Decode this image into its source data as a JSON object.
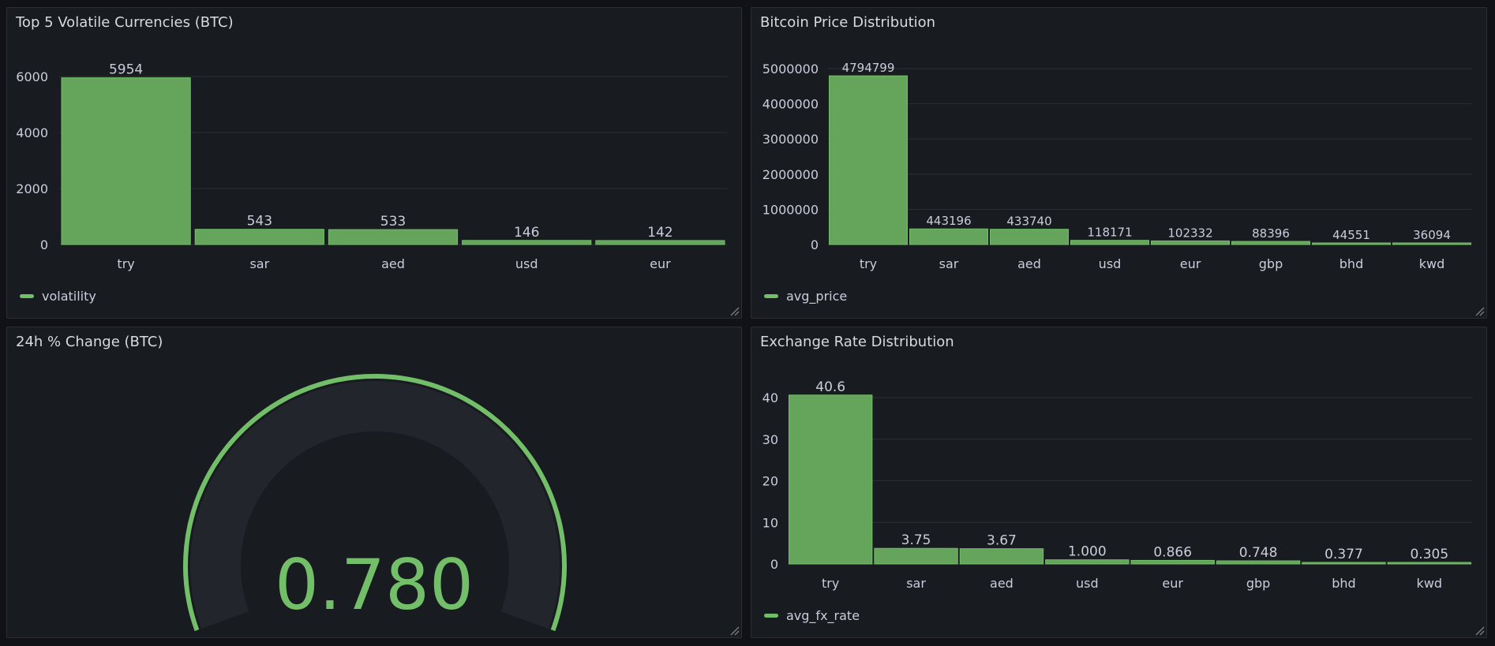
{
  "colors": {
    "bar_fill": "#64a55b",
    "bar_stroke": "#73bf69",
    "accent": "#73bf69",
    "grid": "#2c2f35",
    "axis_text": "#ccccdc",
    "gauge_track": "#22252b"
  },
  "icons": {
    "resize": "resize-handle-icon"
  },
  "panels": {
    "volatility": {
      "title": "Top 5 Volatile Currencies (BTC)",
      "legend": "volatility"
    },
    "price": {
      "title": "Bitcoin Price Distribution",
      "legend": "avg_price"
    },
    "change": {
      "title": "24h % Change (BTC)",
      "value_label": "0.780"
    },
    "fx": {
      "title": "Exchange Rate Distribution",
      "legend": "avg_fx_rate"
    }
  },
  "chart_data": [
    {
      "id": "volatility",
      "type": "bar",
      "title": "Top 5 Volatile Currencies (BTC)",
      "categories": [
        "try",
        "sar",
        "aed",
        "usd",
        "eur"
      ],
      "series": [
        {
          "name": "volatility",
          "values": [
            5954,
            543,
            533,
            146,
            142
          ]
        }
      ],
      "value_labels": [
        "5954",
        "543",
        "533",
        "146",
        "142"
      ],
      "yticks": [
        0,
        2000,
        4000,
        6000
      ],
      "ylim": [
        0,
        6000
      ],
      "grid": true,
      "legend": "bottom-left"
    },
    {
      "id": "price",
      "type": "bar",
      "title": "Bitcoin Price Distribution",
      "categories": [
        "try",
        "sar",
        "aed",
        "usd",
        "eur",
        "gbp",
        "bhd",
        "kwd"
      ],
      "series": [
        {
          "name": "avg_price",
          "values": [
            4794799,
            443196,
            433740,
            118171,
            102332,
            88396,
            44551,
            36094
          ]
        }
      ],
      "value_labels": [
        "4794799",
        "443196",
        "433740",
        "118171",
        "102332",
        "88396",
        "44551",
        "36094"
      ],
      "yticks": [
        0,
        1000000,
        2000000,
        3000000,
        4000000,
        5000000
      ],
      "ylim": [
        0,
        5000000
      ],
      "grid": true,
      "legend": "bottom-left"
    },
    {
      "id": "change",
      "type": "gauge",
      "title": "24h % Change (BTC)",
      "value": 0.78,
      "display": "0.780"
    },
    {
      "id": "fx",
      "type": "bar",
      "title": "Exchange Rate Distribution",
      "categories": [
        "try",
        "sar",
        "aed",
        "usd",
        "eur",
        "gbp",
        "bhd",
        "kwd"
      ],
      "series": [
        {
          "name": "avg_fx_rate",
          "values": [
            40.6,
            3.75,
            3.67,
            1.0,
            0.866,
            0.748,
            0.377,
            0.305
          ]
        }
      ],
      "value_labels": [
        "40.6",
        "3.75",
        "3.67",
        "1.000",
        "0.866",
        "0.748",
        "0.377",
        "0.305"
      ],
      "yticks": [
        0,
        10,
        20,
        30,
        40
      ],
      "ylim": [
        0,
        40
      ],
      "grid": true,
      "legend": "bottom-left"
    }
  ]
}
